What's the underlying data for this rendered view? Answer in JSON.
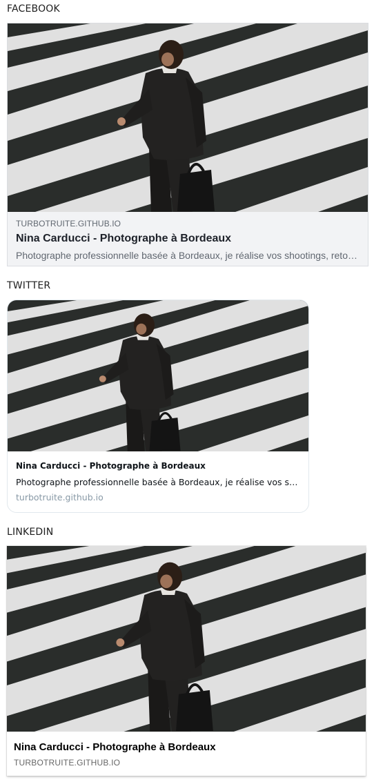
{
  "facebook": {
    "section_label": "FACEBOOK",
    "domain": "TURBOTRUITE.GITHUB.IO",
    "title": "Nina Carducci - Photographe à Bordeaux",
    "description": "Photographe professionnelle basée à Bordeaux, je réalise vos shootings, reto…"
  },
  "twitter": {
    "section_label": "TWITTER",
    "title": "Nina Carducci - Photographe à Bordeaux",
    "description": "Photographe professionnelle basée à Bordeaux, je réalise vos sh…",
    "domain": "turbotruite.github.io"
  },
  "linkedin": {
    "section_label": "LINKEDIN",
    "title": "Nina Carducci - Photographe à Bordeaux",
    "domain": "TURBOTRUITE.GITHUB.IO"
  },
  "colors": {
    "stripe_light": "#eeeeee",
    "stripe_dark": "#2f3230",
    "suit": "#1e1d1c"
  }
}
